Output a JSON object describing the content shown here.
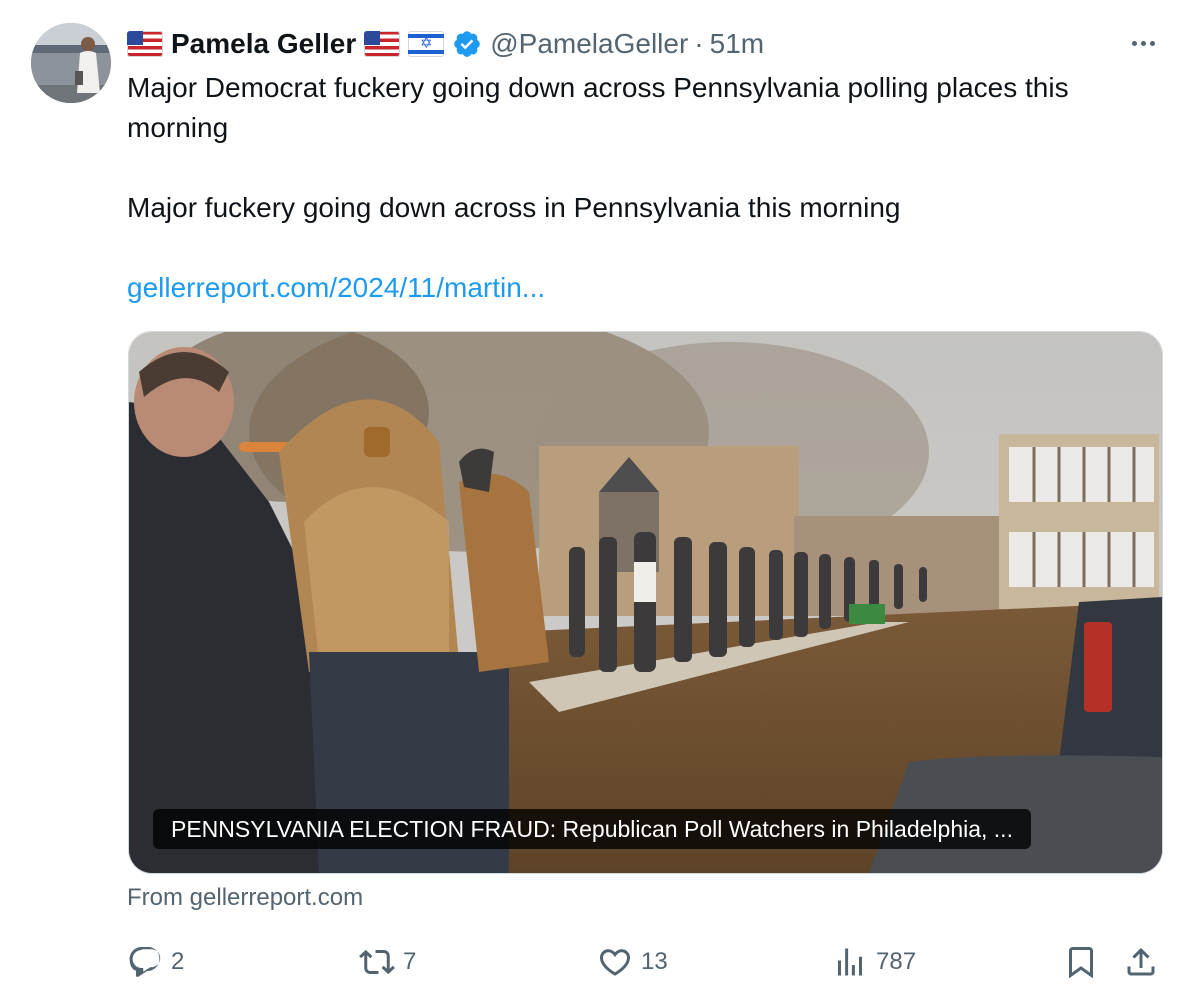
{
  "author": {
    "display_name": "Pamela Geller",
    "handle": "@PamelaGeller",
    "separator": "·",
    "timestamp": "51m",
    "flags": [
      "us-flag",
      "us-flag",
      "israel-flag"
    ],
    "verified": true
  },
  "tweet": {
    "paragraphs": [
      "Major Democrat fuckery going down across Pennsylvania polling places this morning",
      "Major fuckery going down across in Pennsylvania this morning"
    ],
    "link_text": "gellerreport.com/2024/11/martin..."
  },
  "card": {
    "caption": "PENNSYLVANIA ELECTION FRAUD: Republican Poll Watchers in Philadelphia, ...",
    "source": "From gellerreport.com"
  },
  "actions": {
    "replies": "2",
    "reposts": "7",
    "likes": "13",
    "views": "787"
  },
  "colors": {
    "text": "#0f1419",
    "secondary": "#536471",
    "link": "#1d9bf0",
    "verified": "#1d9bf0",
    "border": "#cfd9de"
  }
}
